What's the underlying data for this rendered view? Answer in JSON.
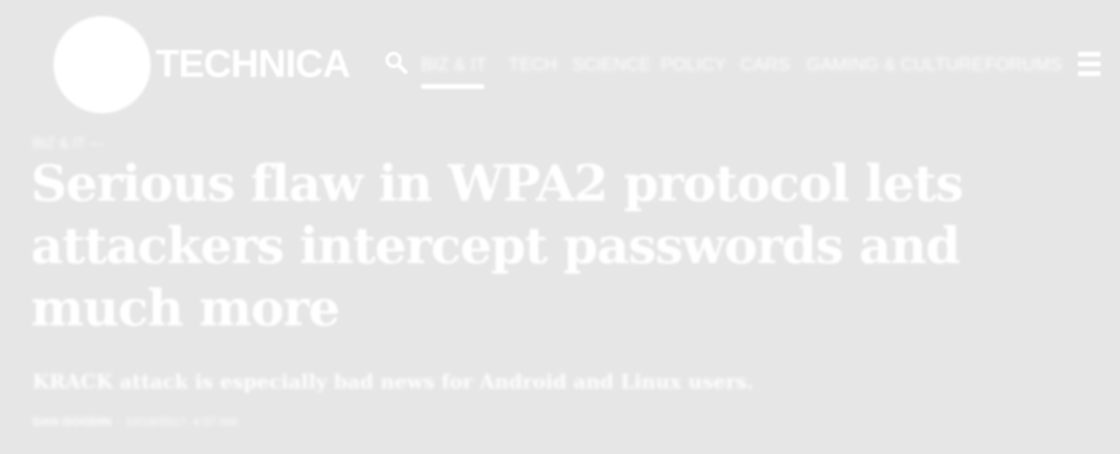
{
  "site": {
    "logo_text": "TECHNICA"
  },
  "nav": {
    "items": [
      {
        "label": "BIZ & IT"
      },
      {
        "label": "TECH"
      },
      {
        "label": "SCIENCE"
      },
      {
        "label": "POLICY"
      },
      {
        "label": "CARS"
      },
      {
        "label": "GAMING & CULTURE"
      },
      {
        "label": "FORUMS"
      }
    ],
    "active_index": 0
  },
  "icons": {
    "search": "search-icon",
    "menu": "hamburger-menu-icon"
  },
  "article": {
    "kicker": "BIZ & IT —",
    "headline": "Serious flaw in WPA2 protocol lets attackers intercept passwords and much more",
    "dek": "KRACK attack is especially bad news for Android and Linux users.",
    "author": "DAN GOODIN",
    "byline_separator": "-",
    "timestamp": "10/16/2017, 4:37 AM"
  },
  "colors": {
    "background": "#e6e6e6",
    "foreground": "#ffffff"
  }
}
